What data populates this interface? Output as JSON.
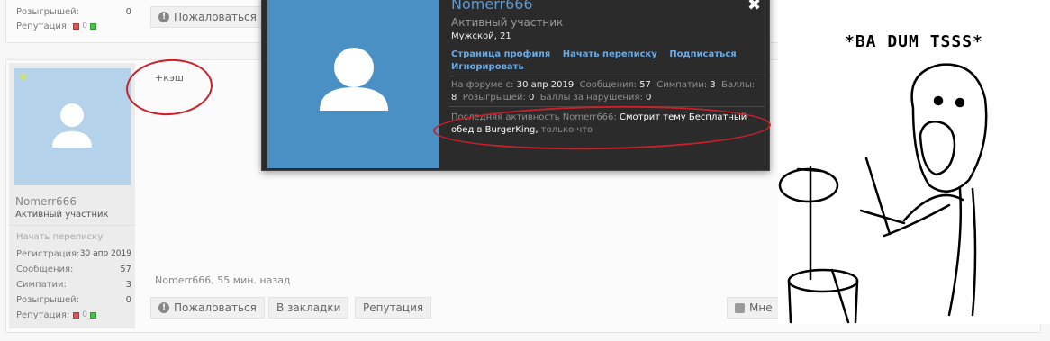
{
  "prev_post": {
    "raffles_label": "Розыгрышей:",
    "raffles_value": "0",
    "reputation_label": "Репутация:",
    "rep_neg": "0",
    "report_button": "Пожаловаться"
  },
  "post": {
    "text": "+кэш",
    "meta": "Nomerr666, 55 мин. назад",
    "buttons": {
      "report": "Пожаловаться",
      "bookmark": "В закладки",
      "reputation": "Репутация",
      "like": "Мне"
    }
  },
  "sidebar": {
    "username": "Nomerr666",
    "user_title": "Активный участник",
    "start_conversation": "Начать переписку",
    "stats": [
      {
        "label": "Регистрация:",
        "value": "30 апр 2019"
      },
      {
        "label": "Сообщения:",
        "value": "57"
      },
      {
        "label": "Симпатии:",
        "value": "3"
      },
      {
        "label": "Розыгрышей:",
        "value": "0"
      }
    ],
    "reputation_label": "Репутация:",
    "rep_neg": "0"
  },
  "popup": {
    "name": "Nomerr666",
    "title": "Активный участник",
    "gender_age": "Мужской, 21",
    "links": {
      "profile": "Страница профиля",
      "conversation": "Начать переписку",
      "follow": "Подписаться",
      "ignore": "Игнорировать"
    },
    "stats": {
      "on_forum_label": "На форуме с:",
      "on_forum_value": "30 апр 2019",
      "messages_label": "Сообщения:",
      "messages_value": "57",
      "likes_label": "Симпатии:",
      "likes_value": "3",
      "points_label": "Баллы:",
      "points_value": "8",
      "raffles_label": "Розыгрышей:",
      "raffles_value": "0",
      "violation_label": "Баллы за нарушения:",
      "violation_value": "0"
    },
    "activity": {
      "prefix": "Последняя активность Nomerr666:",
      "action": "Смотрит тему Бесплатный обед в BurgerKing,",
      "time": "только что"
    },
    "close": "✖"
  },
  "meme": {
    "caption": "*BA DUM TSSS*"
  },
  "colors": {
    "popup_bg": "#2b2b2b",
    "avatar_blue": "#4a90c4",
    "link_blue": "#6ca9e0",
    "annotation_red": "#cc1f2a"
  }
}
